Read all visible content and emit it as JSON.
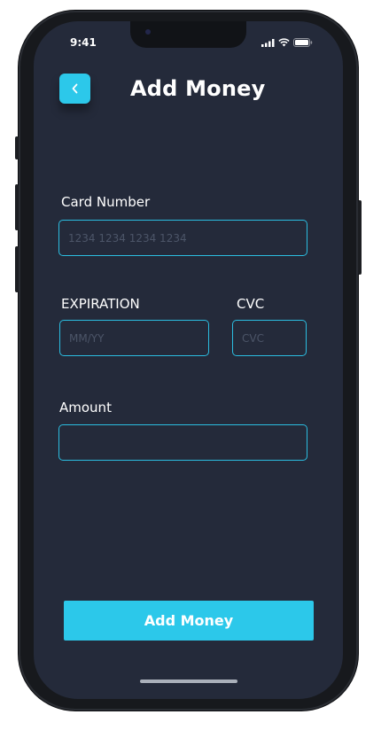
{
  "status_bar": {
    "time": "9:41",
    "icons": [
      "cellular-signal-icon",
      "wifi-icon",
      "battery-icon"
    ]
  },
  "header": {
    "back_icon": "chevron-left-icon",
    "title": "Add Money"
  },
  "form": {
    "card_number": {
      "label": "Card Number",
      "placeholder": "1234 1234 1234 1234",
      "value": ""
    },
    "expiration": {
      "label": "EXPIRATION",
      "placeholder": "MM/YY",
      "value": ""
    },
    "cvc": {
      "label": "CVC",
      "placeholder": "CVC",
      "value": ""
    },
    "amount": {
      "label": "Amount",
      "placeholder": "",
      "value": ""
    }
  },
  "submit": {
    "label": "Add Money"
  },
  "colors": {
    "background": "#242a3a",
    "accent": "#2cc8ea",
    "field_border": "#2bbde0",
    "text": "#ffffff"
  }
}
